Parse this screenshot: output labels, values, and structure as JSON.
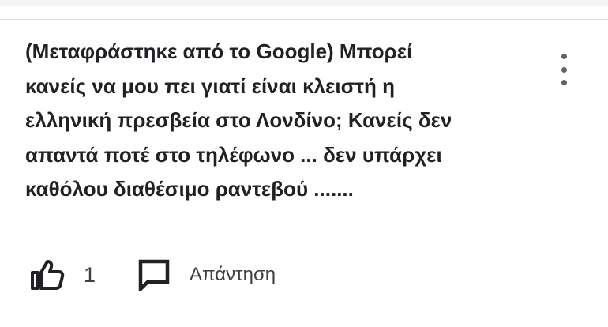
{
  "review": {
    "text": "(Μεταφράστηκε από το Google) Μπορεί\nκανείς να μου πει γιατί είναι κλειστή η\nελληνική πρεσβεία στο Λονδίνο; Κανείς δεν\nαπαντά ποτέ στο τηλέφωνο ... δεν υπάρχει\nκαθόλου διαθέσιμο ραντεβού ......."
  },
  "actions": {
    "like_count": "1",
    "reply_label": "Απάντηση"
  },
  "icons": {
    "like": "thumbs-up-icon",
    "reply": "reply-icon",
    "more": "more-vert-icon"
  },
  "colors": {
    "text": "#202124",
    "icon": "#202124",
    "secondary_text": "#3c4043",
    "more_dots": "#5f6368",
    "divider": "#dadce0"
  }
}
